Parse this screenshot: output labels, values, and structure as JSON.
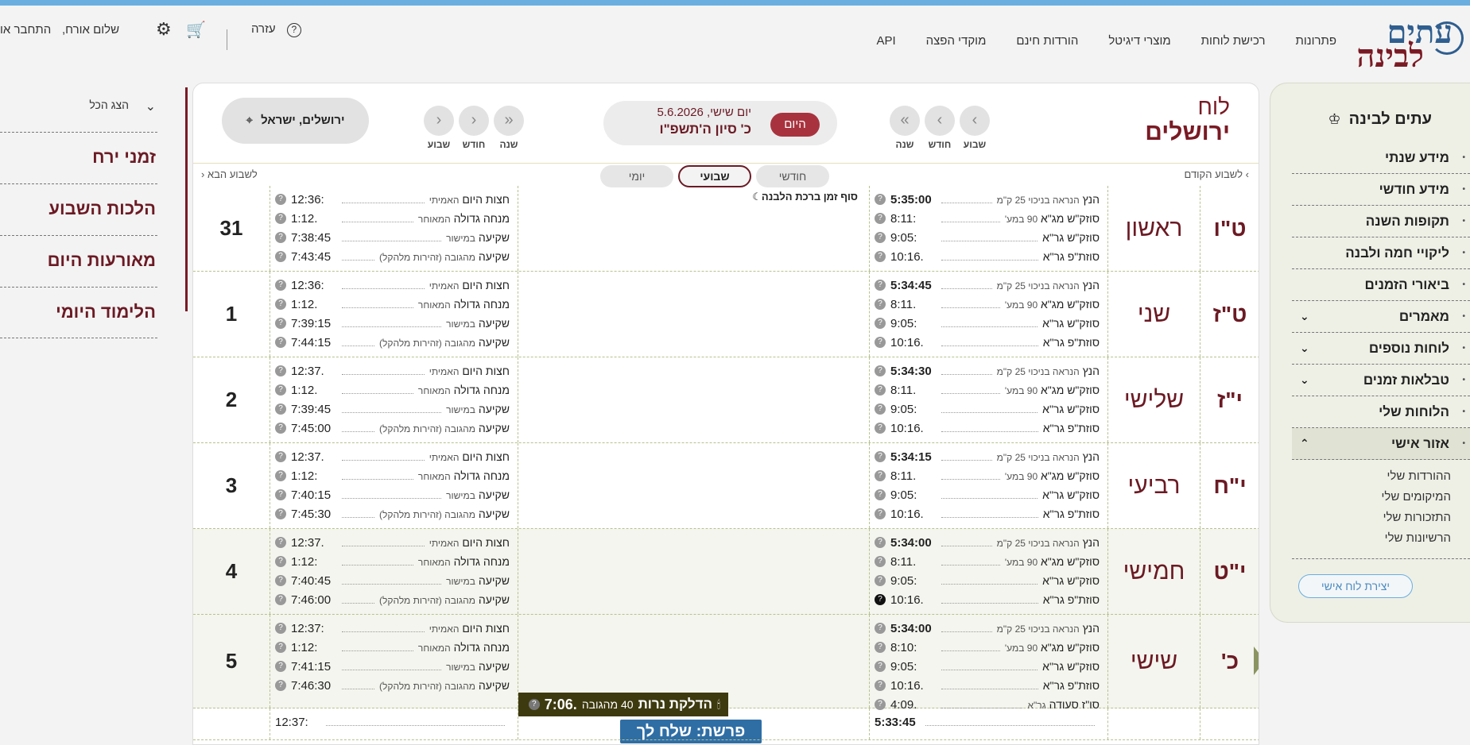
{
  "header": {
    "logo_top": "עתים",
    "logo_bottom": "לבינה",
    "nav": [
      "פתרונות",
      "רכישת לוחות",
      "מוצרי דיגיטל",
      "הורדות חינם",
      "מוקדי הפצה",
      "API"
    ],
    "help": "עזרה",
    "greeting": "שלום אורח,",
    "login": "התחבר או"
  },
  "sidebar": {
    "title": "עתים לבינה",
    "items": [
      {
        "label": "מידע שנתי",
        "chev": ""
      },
      {
        "label": "מידע חודשי",
        "chev": ""
      },
      {
        "label": "תקופות השנה",
        "chev": ""
      },
      {
        "label": "ליקויי חמה ולבנה",
        "chev": ""
      },
      {
        "label": "ביאורי הזמנים",
        "chev": ""
      },
      {
        "label": "מאמרים",
        "chev": "⌄"
      },
      {
        "label": "לוחות נוספים",
        "chev": "⌄"
      },
      {
        "label": "טבלאות זמנים",
        "chev": "⌄"
      },
      {
        "label": "הלוחות שלי",
        "chev": ""
      },
      {
        "label": "אזור אישי",
        "chev": "⌃"
      }
    ],
    "sub": [
      "ההורדות שלי",
      "המיקומים שלי",
      "התזכורות שלי",
      "הרשיונות שלי"
    ],
    "create_btn": "יצירת לוח אישי"
  },
  "left": {
    "show_all": "הצג הכל",
    "links": [
      "זמני ירח",
      "הלכות השבוע",
      "מאורעות היום",
      "הלימוד היומי"
    ]
  },
  "main": {
    "title_a": "לוח",
    "title_b": "ירושלים",
    "today_btn": "היום",
    "date_greg": "יום שישי, 5.6.2026",
    "date_heb": "כ' סיון ה'תשפ\"ו",
    "nav_labels": {
      "week": "שבוע",
      "month": "חודש",
      "year": "שנה"
    },
    "location": "ירושלים, ישראל",
    "prev_week": "לשבוע הקודם",
    "next_week": "לשבוע הבא",
    "tabs": {
      "monthly": "חודשי",
      "weekly": "שבועי",
      "daily": "יומי"
    },
    "moon_note": "סוף זמן ברכת הלבנה",
    "candle_label": "הדלקת נרות",
    "candle_sub": "40 מהגובה",
    "candle_time": "7:06.",
    "parsha": "פרשת: שלח לך"
  },
  "rows": [
    {
      "hdate": "ט\"ו",
      "day": "ראשון",
      "gnum": "31",
      "left": [
        [
          "הנץ",
          "הנראה בניכוי 25 ק\"מ",
          "5:35:00",
          true
        ],
        [
          "סוזק\"ש מג\"א",
          "90 במע'",
          "8:11:",
          false
        ],
        [
          "סוזק\"ש גר\"א",
          "",
          "9:05:",
          false
        ],
        [
          "סוזת\"פ גר\"א",
          "",
          "10:16.",
          false
        ]
      ],
      "right": [
        [
          "חצות היום",
          "האמיתי",
          "12:36:"
        ],
        [
          "מנחה גדולה",
          "המאוחר",
          "1:12."
        ],
        [
          "שקיעה",
          "במישור",
          "7:38:45"
        ],
        [
          "שקיעה",
          "מהגובה (זהירות מלהקל)",
          "7:43:45"
        ]
      ]
    },
    {
      "hdate": "ט\"ז",
      "day": "שני",
      "gnum": "1",
      "left": [
        [
          "הנץ",
          "הנראה בניכוי 25 ק\"מ",
          "5:34:45",
          true
        ],
        [
          "סוזק\"ש מג\"א",
          "90 במע'",
          "8:11.",
          false
        ],
        [
          "סוזק\"ש גר\"א",
          "",
          "9:05:",
          false
        ],
        [
          "סוזת\"פ גר\"א",
          "",
          "10:16.",
          false
        ]
      ],
      "right": [
        [
          "חצות היום",
          "האמיתי",
          "12:36:"
        ],
        [
          "מנחה גדולה",
          "המאוחר",
          "1:12."
        ],
        [
          "שקיעה",
          "במישור",
          "7:39:15"
        ],
        [
          "שקיעה",
          "מהגובה (זהירות מלהקל)",
          "7:44:15"
        ]
      ]
    },
    {
      "hdate": "י\"ז",
      "day": "שלישי",
      "gnum": "2",
      "left": [
        [
          "הנץ",
          "הנראה בניכוי 25 ק\"מ",
          "5:34:30",
          true
        ],
        [
          "סוזק\"ש מג\"א",
          "90 במע'",
          "8:11.",
          false
        ],
        [
          "סוזק\"ש גר\"א",
          "",
          "9:05:",
          false
        ],
        [
          "סוזת\"פ גר\"א",
          "",
          "10:16.",
          false
        ]
      ],
      "right": [
        [
          "חצות היום",
          "האמיתי",
          "12:37."
        ],
        [
          "מנחה גדולה",
          "המאוחר",
          "1:12."
        ],
        [
          "שקיעה",
          "במישור",
          "7:39:45"
        ],
        [
          "שקיעה",
          "מהגובה (זהירות מלהקל)",
          "7:45:00"
        ]
      ]
    },
    {
      "hdate": "י\"ח",
      "day": "רביעי",
      "gnum": "3",
      "left": [
        [
          "הנץ",
          "הנראה בניכוי 25 ק\"מ",
          "5:34:15",
          true
        ],
        [
          "סוזק\"ש מג\"א",
          "90 במע'",
          "8:11.",
          false
        ],
        [
          "סוזק\"ש גר\"א",
          "",
          "9:05:",
          false
        ],
        [
          "סוזת\"פ גר\"א",
          "",
          "10:16.",
          false
        ]
      ],
      "right": [
        [
          "חצות היום",
          "האמיתי",
          "12:37."
        ],
        [
          "מנחה גדולה",
          "המאוחר",
          "1:12:"
        ],
        [
          "שקיעה",
          "במישור",
          "7:40:15"
        ],
        [
          "שקיעה",
          "מהגובה (זהירות מלהקל)",
          "7:45:30"
        ]
      ]
    },
    {
      "hdate": "י\"ט",
      "day": "חמישי",
      "gnum": "4",
      "left": [
        [
          "הנץ",
          "הנראה בניכוי 25 ק\"מ",
          "5:34:00",
          true
        ],
        [
          "סוזק\"ש מג\"א",
          "90 במע'",
          "8:11.",
          false
        ],
        [
          "סוזק\"ש גר\"א",
          "",
          "9:05:",
          false
        ],
        [
          "סוזת\"פ גר\"א",
          "",
          "10:16.",
          false
        ]
      ],
      "right": [
        [
          "חצות היום",
          "האמיתי",
          "12:37."
        ],
        [
          "מנחה גדולה",
          "המאוחר",
          "1:12:"
        ],
        [
          "שקיעה",
          "במישור",
          "7:40:45"
        ],
        [
          "שקיעה",
          "מהגובה (זהירות מלהקל)",
          "7:46:00"
        ]
      ]
    },
    {
      "hdate": "כ'",
      "day": "שישי",
      "gnum": "5",
      "left": [
        [
          "הנץ",
          "הנראה בניכוי 25 ק\"מ",
          "5:34:00",
          true
        ],
        [
          "סוזק\"ש מג\"א",
          "90 במע'",
          "8:10:",
          false
        ],
        [
          "סוזק\"ש גר\"א",
          "",
          "9:05:",
          false
        ],
        [
          "סוזת\"פ גר\"א",
          "",
          "10:16.",
          false
        ],
        [
          "סו\"ז סעודה",
          "גר\"א",
          "4:09.",
          false
        ]
      ],
      "right": [
        [
          "חצות היום",
          "האמיתי",
          "12:37:"
        ],
        [
          "מנחה גדולה",
          "המאוחר",
          "1:12:"
        ],
        [
          "שקיעה",
          "במישור",
          "7:41:15"
        ],
        [
          "שקיעה",
          "מהגובה (זהירות מלהקל)",
          "7:46:30"
        ]
      ]
    }
  ],
  "partial_row": {
    "left_time": "5:33:45",
    "right_time": "12:37:"
  }
}
